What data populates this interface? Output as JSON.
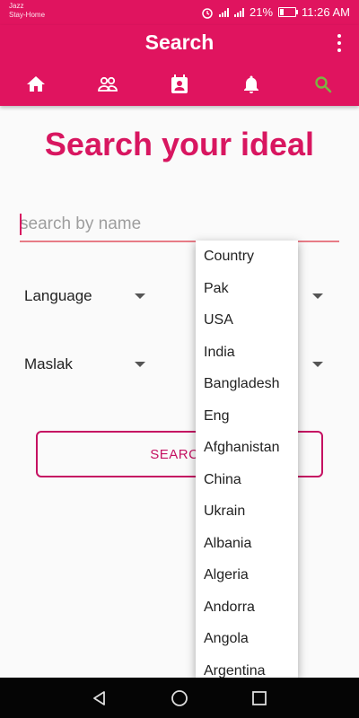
{
  "status_bar": {
    "carrier_line1": "Jazz",
    "carrier_line2": "Stay-Home",
    "battery": "21%",
    "time": "11:26 AM"
  },
  "app_bar": {
    "title": "Search",
    "tabs": [
      {
        "name": "home",
        "icon": "home-icon",
        "selected": false
      },
      {
        "name": "people",
        "icon": "people-icon",
        "selected": false
      },
      {
        "name": "contacts",
        "icon": "contact-card-icon",
        "selected": false
      },
      {
        "name": "notifications",
        "icon": "bell-icon",
        "selected": false
      },
      {
        "name": "search",
        "icon": "search-icon",
        "selected": true
      }
    ],
    "colors": {
      "primary": "#e0145f",
      "selected_tab": "#7cb342"
    }
  },
  "main": {
    "headline": "Search your ideal",
    "search_input": {
      "placeholder": "search by name",
      "value": ""
    },
    "dropdowns": {
      "language": "Language",
      "maslak": "Maslak"
    },
    "search_button": "SEARCH"
  },
  "country_popup": {
    "items": [
      "Country",
      "Pak",
      "USA",
      "India",
      "Bangladesh",
      "Eng",
      "Afghanistan",
      "China",
      "Ukrain",
      "Albania",
      "Algeria",
      "Andorra",
      "Angola",
      "Argentina"
    ]
  }
}
